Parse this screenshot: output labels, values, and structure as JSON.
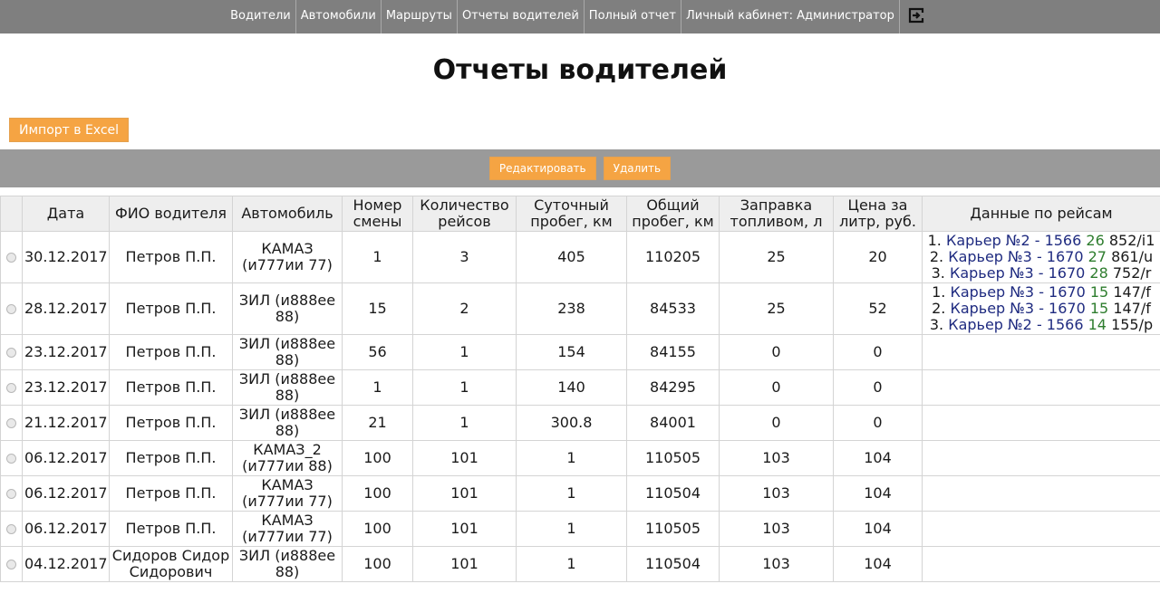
{
  "nav": {
    "items": [
      "Водители",
      "Автомобили",
      "Маршруты",
      "Отчеты водителей",
      "Полный отчет",
      "Личный кабинет: Администратор"
    ]
  },
  "page": {
    "title": "Отчеты водителей",
    "excel_label": "Импорт в Excel",
    "edit_label": "Редактировать",
    "delete_label": "Удалить"
  },
  "table": {
    "headers": [
      "Дата",
      "ФИО водителя",
      "Автомобиль",
      "Номер смены",
      "Количество рейсов",
      "Суточный пробег, км",
      "Общий пробег, км",
      "Заправка топливом, л",
      "Цена за литр, руб.",
      "Данные по рейсам"
    ],
    "rows": [
      {
        "date": "30.12.2017",
        "driver": "Петров П.П.",
        "car": "КАМАЗ (и777ии 77)",
        "shift": "1",
        "trips_count": "3",
        "daily": "405",
        "total": "110205",
        "fuel": "25",
        "price": "20",
        "trips": [
          {
            "num": "1. ",
            "route": "Карьер №2 - 1566",
            "mid": " 26",
            "tail": " 852/i1"
          },
          {
            "num": "2. ",
            "route": "Карьер №3 - 1670",
            "mid": " 27",
            "tail": " 861/u"
          },
          {
            "num": "3. ",
            "route": "Карьер №3 - 1670",
            "mid": " 28",
            "tail": " 752/r"
          }
        ]
      },
      {
        "date": "28.12.2017",
        "driver": "Петров П.П.",
        "car": "ЗИЛ (и888ее 88)",
        "shift": "15",
        "trips_count": "2",
        "daily": "238",
        "total": "84533",
        "fuel": "25",
        "price": "52",
        "trips": [
          {
            "num": "1. ",
            "route": "Карьер №3 - 1670",
            "mid": " 15",
            "tail": " 147/f"
          },
          {
            "num": "2. ",
            "route": "Карьер №3 - 1670",
            "mid": " 15",
            "tail": " 147/f"
          },
          {
            "num": "3. ",
            "route": "Карьер №2 - 1566",
            "mid": " 14",
            "tail": " 155/p"
          }
        ]
      },
      {
        "date": "23.12.2017",
        "driver": "Петров П.П.",
        "car": "ЗИЛ (и888ее 88)",
        "shift": "56",
        "trips_count": "1",
        "daily": "154",
        "total": "84155",
        "fuel": "0",
        "price": "0",
        "trips": []
      },
      {
        "date": "23.12.2017",
        "driver": "Петров П.П.",
        "car": "ЗИЛ (и888ее 88)",
        "shift": "1",
        "trips_count": "1",
        "daily": "140",
        "total": "84295",
        "fuel": "0",
        "price": "0",
        "trips": []
      },
      {
        "date": "21.12.2017",
        "driver": "Петров П.П.",
        "car": "ЗИЛ (и888ее 88)",
        "shift": "21",
        "trips_count": "1",
        "daily": "300.8",
        "total": "84001",
        "fuel": "0",
        "price": "0",
        "trips": []
      },
      {
        "date": "06.12.2017",
        "driver": "Петров П.П.",
        "car": "КАМАЗ_2 (и777ии 88)",
        "shift": "100",
        "trips_count": "101",
        "daily": "1",
        "total": "110505",
        "fuel": "103",
        "price": "104",
        "trips": []
      },
      {
        "date": "06.12.2017",
        "driver": "Петров П.П.",
        "car": "КАМАЗ (и777ии 77)",
        "shift": "100",
        "trips_count": "101",
        "daily": "1",
        "total": "110504",
        "fuel": "103",
        "price": "104",
        "trips": []
      },
      {
        "date": "06.12.2017",
        "driver": "Петров П.П.",
        "car": "КАМАЗ (и777ии 77)",
        "shift": "100",
        "trips_count": "101",
        "daily": "1",
        "total": "110505",
        "fuel": "103",
        "price": "104",
        "trips": []
      },
      {
        "date": "04.12.2017",
        "driver": "Сидоров Сидор Сидорович",
        "car": "ЗИЛ (и888ее 88)",
        "shift": "100",
        "trips_count": "101",
        "daily": "1",
        "total": "110504",
        "fuel": "103",
        "price": "104",
        "trips": []
      }
    ]
  }
}
